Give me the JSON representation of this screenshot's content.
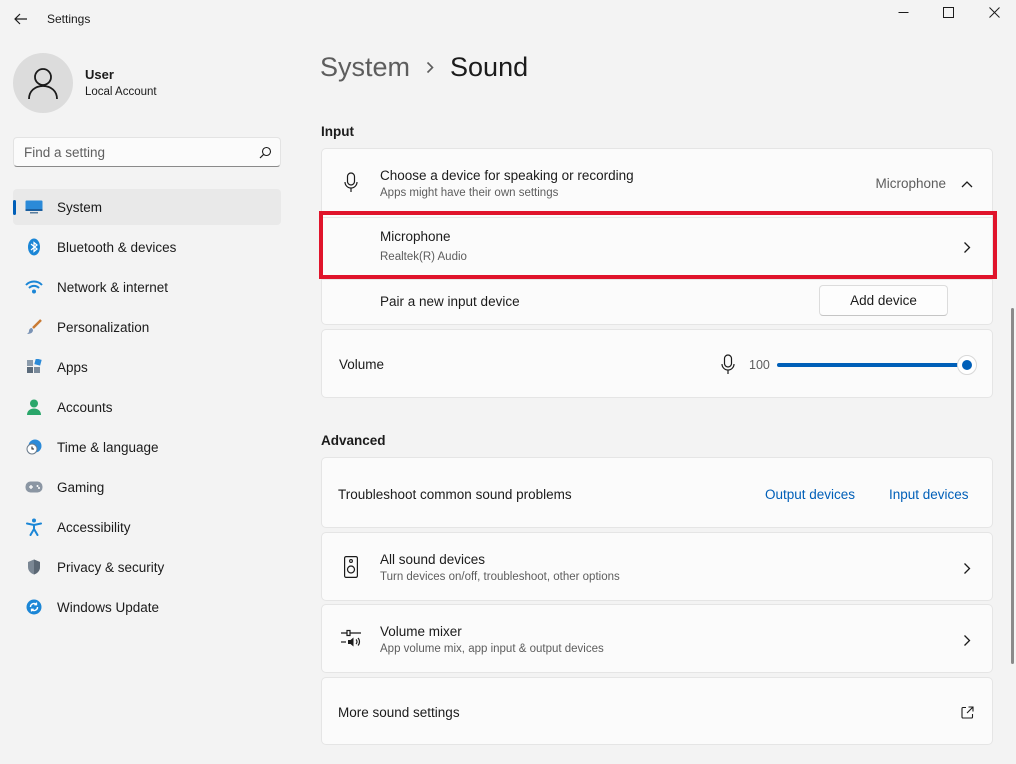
{
  "window": {
    "title": "Settings",
    "controls": {
      "minimize": "minimize-icon",
      "maximize": "maximize-icon",
      "close": "close-icon"
    }
  },
  "user": {
    "name": "User",
    "account": "Local Account"
  },
  "search": {
    "placeholder": "Find a setting"
  },
  "sidebar": {
    "items": [
      {
        "label": "System",
        "icon": "system-icon",
        "active": true
      },
      {
        "label": "Bluetooth & devices",
        "icon": "bluetooth-icon"
      },
      {
        "label": "Network & internet",
        "icon": "wifi-icon"
      },
      {
        "label": "Personalization",
        "icon": "brush-icon"
      },
      {
        "label": "Apps",
        "icon": "apps-icon"
      },
      {
        "label": "Accounts",
        "icon": "accounts-icon"
      },
      {
        "label": "Time & language",
        "icon": "time-language-icon"
      },
      {
        "label": "Gaming",
        "icon": "gamepad-icon"
      },
      {
        "label": "Accessibility",
        "icon": "accessibility-icon"
      },
      {
        "label": "Privacy & security",
        "icon": "shield-icon"
      },
      {
        "label": "Windows Update",
        "icon": "update-icon"
      }
    ]
  },
  "breadcrumb": {
    "parent": "System",
    "current": "Sound"
  },
  "input": {
    "section_title": "Input",
    "choose_device": {
      "title": "Choose a device for speaking or recording",
      "subtitle": "Apps might have their own settings",
      "selected": "Microphone"
    },
    "device": {
      "title": "Microphone",
      "subtitle": "Realtek(R) Audio"
    },
    "pair": {
      "label": "Pair a new input device",
      "button": "Add device"
    },
    "volume": {
      "label": "Volume",
      "value": "100",
      "level": 1.0
    }
  },
  "advanced": {
    "section_title": "Advanced",
    "troubleshoot": {
      "label": "Troubleshoot common sound problems",
      "link_output": "Output devices",
      "link_input": "Input devices"
    },
    "all_devices": {
      "title": "All sound devices",
      "subtitle": "Turn devices on/off, troubleshoot, other options"
    },
    "mixer": {
      "title": "Volume mixer",
      "subtitle": "App volume mix, app input & output devices"
    },
    "more": {
      "label": "More sound settings"
    }
  },
  "colors": {
    "accent": "#005fb8",
    "highlight": "#e0142b",
    "background": "#f3f3f3"
  }
}
